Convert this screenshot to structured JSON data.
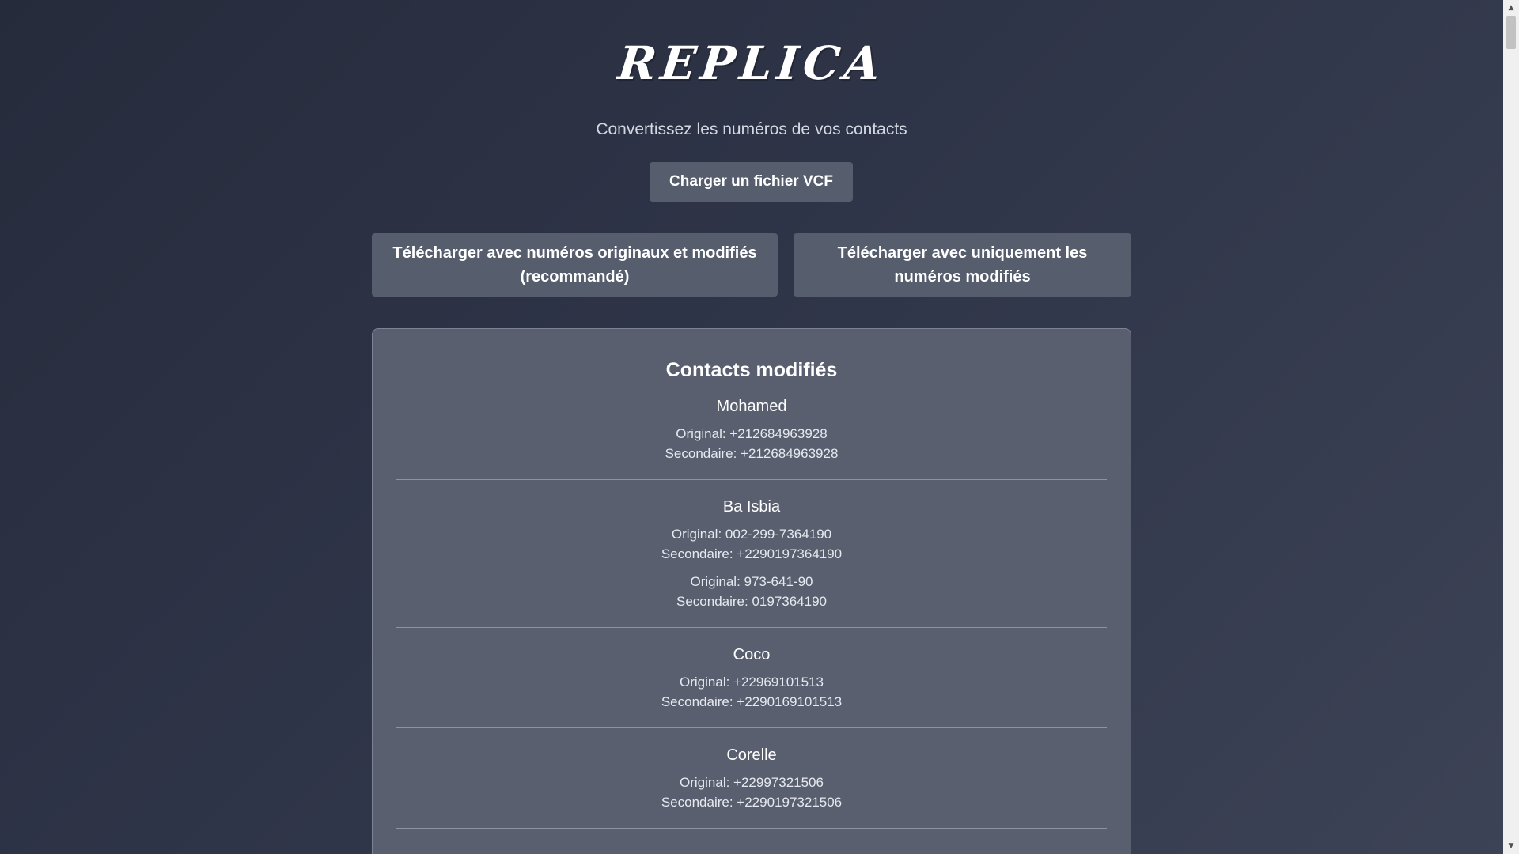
{
  "header": {
    "logo_text": "REPLICA",
    "subtitle": "Convertissez les numéros de vos contacts"
  },
  "actions": {
    "upload_label": "Charger un fichier VCF",
    "download_both_label": "Télécharger avec numéros originaux et modifiés (recommandé)",
    "download_modified_label": "Télécharger avec uniquement les numéros modifiés"
  },
  "contacts_panel": {
    "title": "Contacts modifiés",
    "contacts": [
      {
        "name": "Mohamed",
        "numbers": [
          {
            "original": "Original: +212684963928",
            "secondary": "Secondaire: +212684963928"
          }
        ]
      },
      {
        "name": "Ba Isbia",
        "numbers": [
          {
            "original": "Original: 002-299-7364190",
            "secondary": "Secondaire: +2290197364190"
          },
          {
            "original": "Original: 973-641-90",
            "secondary": "Secondaire: 0197364190"
          }
        ]
      },
      {
        "name": "Coco",
        "numbers": [
          {
            "original": "Original: +22969101513",
            "secondary": "Secondaire: +2290169101513"
          }
        ]
      },
      {
        "name": "Corelle",
        "numbers": [
          {
            "original": "Original: +22997321506",
            "secondary": "Secondaire: +2290197321506"
          }
        ]
      }
    ]
  },
  "scrollbar": {
    "up_icon": "scroll-up-arrow-icon",
    "down_icon": "scroll-down-arrow-icon"
  }
}
